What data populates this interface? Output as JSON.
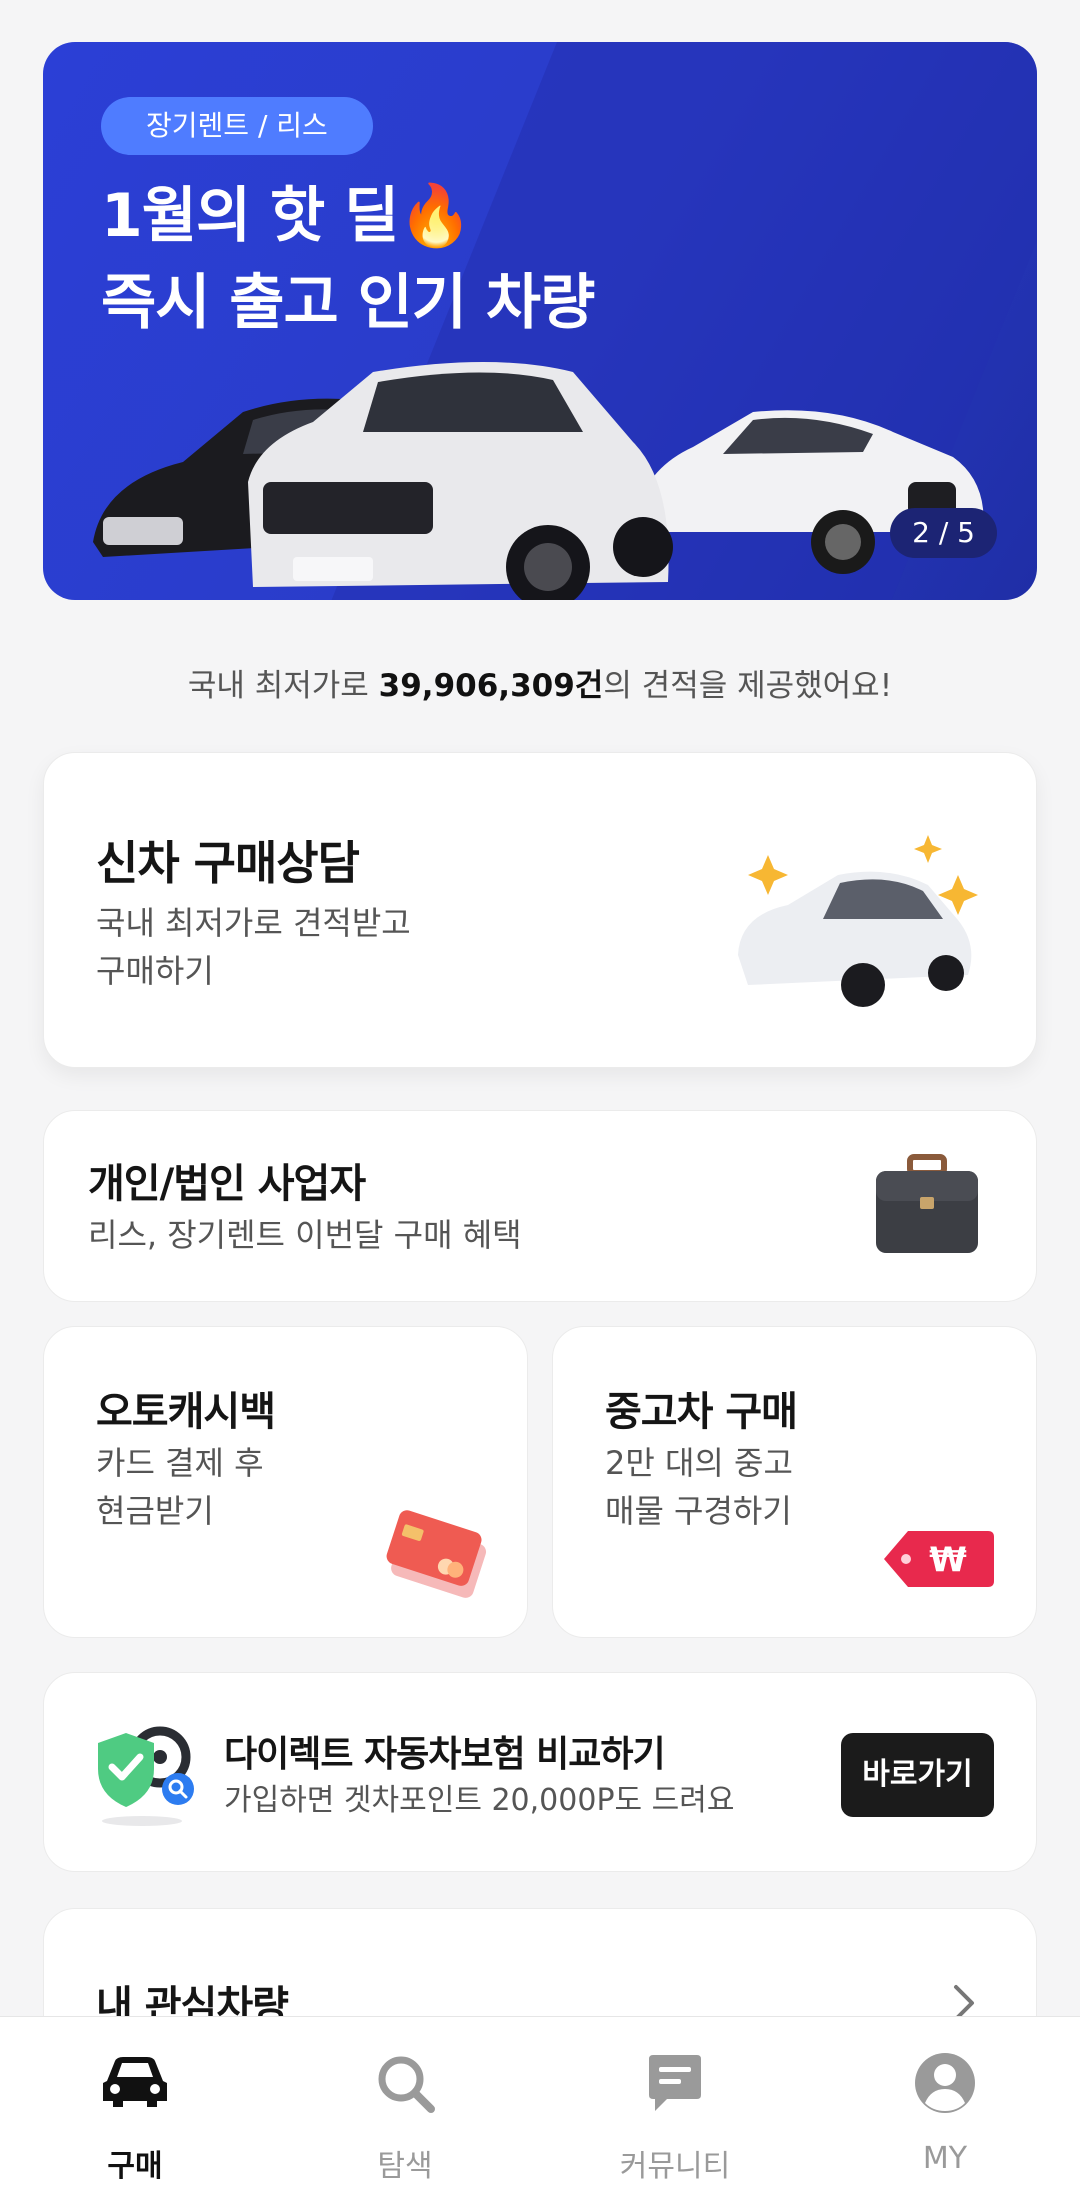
{
  "banner": {
    "tag": "장기렌트 / 리스",
    "line1": "1월의 핫 딜🔥",
    "line2": "즉시 출고 인기 차량",
    "counter": "2 / 5"
  },
  "stats": {
    "prefix": "국내 최저가로 ",
    "count": "39,906,309건",
    "suffix": "의 견적을 제공했어요!"
  },
  "new_car": {
    "title": "신차 구매상담",
    "sub1": "국내 최저가로 견적받고",
    "sub2": "구매하기"
  },
  "business": {
    "title": "개인/법인 사업자",
    "sub": "리스, 장기렌트 이번달 구매 혜택"
  },
  "cashback": {
    "title": "오토캐시백",
    "sub1": "카드 결제 후",
    "sub2": "현금받기"
  },
  "used": {
    "title": "중고차 구매",
    "sub1": "2만 대의 중고",
    "sub2": "매물 구경하기"
  },
  "insurance": {
    "title": "다이렉트 자동차보험 비교하기",
    "sub": "가입하면 겟차포인트 20,000P도 드려요",
    "button": "바로가기"
  },
  "favorites": {
    "title": "내 관심차량"
  },
  "tabbar": [
    {
      "label": "구매",
      "icon": "car-icon",
      "active": true
    },
    {
      "label": "탐색",
      "icon": "search-icon",
      "active": false
    },
    {
      "label": "커뮤니티",
      "icon": "chat-icon",
      "active": false
    },
    {
      "label": "MY",
      "icon": "user-icon",
      "active": false
    }
  ],
  "colors": {
    "banner": "#2b3fd6",
    "tag": "#4f7cff",
    "button": "#1b1b1b",
    "active_tab": "#111111",
    "inactive_tab": "#9a9a9a"
  }
}
